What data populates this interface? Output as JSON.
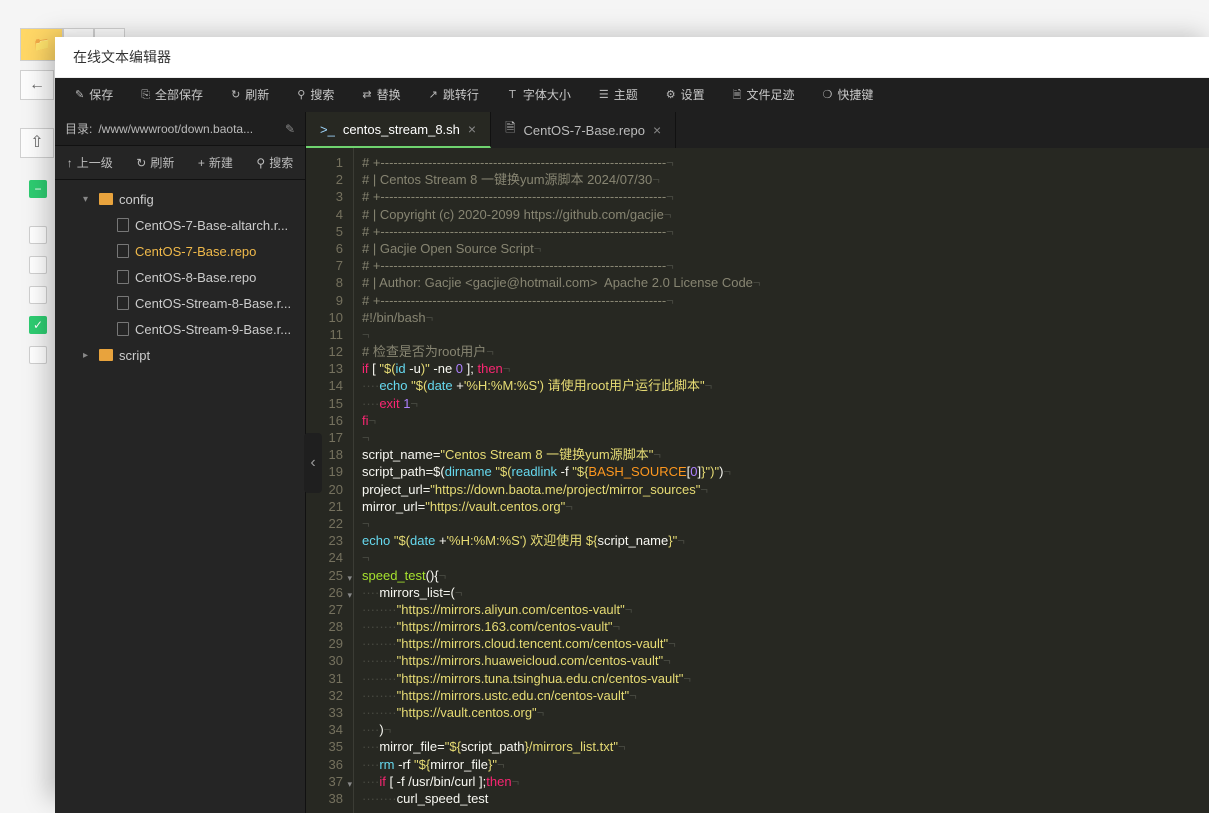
{
  "modal_title": "在线文本编辑器",
  "toolbar": [
    {
      "icon": "✎",
      "label": "保存"
    },
    {
      "icon": "⎘",
      "label": "全部保存"
    },
    {
      "icon": "↻",
      "label": "刷新"
    },
    {
      "icon": "⚲",
      "label": "搜索"
    },
    {
      "icon": "⇄",
      "label": "替换"
    },
    {
      "icon": "↗",
      "label": "跳转行"
    },
    {
      "icon": "Ｔ",
      "label": "字体大小"
    },
    {
      "icon": "☰",
      "label": "主题"
    },
    {
      "icon": "⚙",
      "label": "设置"
    },
    {
      "icon": "🗎",
      "label": "文件足迹"
    },
    {
      "icon": "❍",
      "label": "快捷键"
    }
  ],
  "path_label": "目录:",
  "path_value": "/www/wwwroot/down.baota...",
  "side_tools": [
    {
      "icon": "↑",
      "label": "上一级"
    },
    {
      "icon": "↻",
      "label": "刷新"
    },
    {
      "icon": "+",
      "label": "新建"
    },
    {
      "icon": "⚲",
      "label": "搜索"
    }
  ],
  "tree": [
    {
      "type": "folder",
      "name": "config",
      "expanded": true,
      "level": 1
    },
    {
      "type": "file",
      "name": "CentOS-7-Base-altarch.r...",
      "level": 2
    },
    {
      "type": "file",
      "name": "CentOS-7-Base.repo",
      "level": 2,
      "active": true
    },
    {
      "type": "file",
      "name": "CentOS-8-Base.repo",
      "level": 2
    },
    {
      "type": "file",
      "name": "CentOS-Stream-8-Base.r...",
      "level": 2
    },
    {
      "type": "file",
      "name": "CentOS-Stream-9-Base.r...",
      "level": 2
    },
    {
      "type": "folder",
      "name": "script",
      "expanded": false,
      "level": 1
    }
  ],
  "tabs": [
    {
      "icon": ">_",
      "label": "centos_stream_8.sh",
      "active": true,
      "icon_class": "script"
    },
    {
      "icon": "🗎",
      "label": "CentOS-7-Base.repo",
      "active": false
    }
  ],
  "code": [
    {
      "n": 1,
      "html": "<span class='c-comment'># +------------------------------------------------------------------</span><span class='nl'>¬</span>"
    },
    {
      "n": 2,
      "html": "<span class='c-comment'># | Centos Stream 8 一键换yum源脚本 2024/07/30</span><span class='nl'>¬</span>"
    },
    {
      "n": 3,
      "html": "<span class='c-comment'># +------------------------------------------------------------------</span><span class='nl'>¬</span>"
    },
    {
      "n": 4,
      "html": "<span class='c-comment'># | Copyright (c) 2020-2099 https://github.com/gacjie</span><span class='nl'>¬</span>"
    },
    {
      "n": 5,
      "html": "<span class='c-comment'># +------------------------------------------------------------------</span><span class='nl'>¬</span>"
    },
    {
      "n": 6,
      "html": "<span class='c-comment'># | Gacjie Open Source Script</span><span class='nl'>¬</span>"
    },
    {
      "n": 7,
      "html": "<span class='c-comment'># +------------------------------------------------------------------</span><span class='nl'>¬</span>"
    },
    {
      "n": 8,
      "html": "<span class='c-comment'># | Author: Gacjie &lt;gacjie@hotmail.com&gt;  Apache 2.0 License Code</span><span class='nl'>¬</span>"
    },
    {
      "n": 9,
      "html": "<span class='c-comment'># +------------------------------------------------------------------</span><span class='nl'>¬</span>"
    },
    {
      "n": 10,
      "html": "<span class='c-comment'>#!/bin/bash</span><span class='nl'>¬</span>"
    },
    {
      "n": 11,
      "html": "<span class='nl'>¬</span>"
    },
    {
      "n": 12,
      "html": "<span class='c-comment'># 检查是否为root用户</span><span class='nl'>¬</span>"
    },
    {
      "n": 13,
      "html": "<span class='c-kw'>if</span><span class='c-op'> [ </span><span class='c-str'>\"$(</span><span class='c-fn'>id</span><span class='c-op'> -u</span><span class='c-str'>)\"</span><span class='c-op'> -ne </span><span class='c-num'>0</span><span class='c-op'> ]; </span><span class='c-kw'>then</span><span class='nl'>¬</span>"
    },
    {
      "n": 14,
      "html": "<span class='ws'>····</span><span class='c-fn'>echo</span><span class='c-op'> </span><span class='c-str'>\"$(</span><span class='c-fn'>date</span><span class='c-op'> +</span><span class='c-str'>'%H:%M:%S') 请使用root用户运行此脚本\"</span><span class='nl'>¬</span>"
    },
    {
      "n": 15,
      "html": "<span class='ws'>····</span><span class='c-kw'>exit</span><span class='c-op'> </span><span class='c-num'>1</span><span class='nl'>¬</span>"
    },
    {
      "n": 16,
      "html": "<span class='c-kw'>fi</span><span class='nl'>¬</span>"
    },
    {
      "n": 17,
      "html": "<span class='nl'>¬</span>"
    },
    {
      "n": 18,
      "html": "<span class='c-var'>script_name</span><span class='c-op'>=</span><span class='c-str'>\"Centos Stream 8 一键换yum源脚本\"</span><span class='nl'>¬</span>"
    },
    {
      "n": 19,
      "html": "<span class='c-var'>script_path</span><span class='c-op'>=$(</span><span class='c-fn'>dirname</span><span class='c-op'> </span><span class='c-str'>\"$(</span><span class='c-fn'>readlink</span><span class='c-op'> -f </span><span class='c-str'>\"${</span><span class='c-param'>BASH_SOURCE</span><span class='c-op'>[</span><span class='c-num'>0</span><span class='c-op'>]</span><span class='c-str'>}\")\"</span><span class='c-op'>)</span><span class='nl'>¬</span>"
    },
    {
      "n": 20,
      "html": "<span class='c-var'>project_url</span><span class='c-op'>=</span><span class='c-str'>\"https://down.baota.me/project/mirror_sources\"</span><span class='nl'>¬</span>"
    },
    {
      "n": 21,
      "html": "<span class='c-var'>mirror_url</span><span class='c-op'>=</span><span class='c-str'>\"https://vault.centos.org\"</span><span class='nl'>¬</span>"
    },
    {
      "n": 22,
      "html": "<span class='nl'>¬</span>"
    },
    {
      "n": 23,
      "html": "<span class='c-fn'>echo</span><span class='c-op'> </span><span class='c-str'>\"$(</span><span class='c-fn'>date</span><span class='c-op'> +</span><span class='c-str'>'%H:%M:%S') 欢迎使用 ${</span><span class='c-var'>script_name</span><span class='c-str'>}\"</span><span class='nl'>¬</span>"
    },
    {
      "n": 24,
      "html": "<span class='nl'>¬</span>"
    },
    {
      "n": 25,
      "fold": true,
      "html": "<span class='c-name'>speed_test</span><span class='c-op'>(){</span><span class='nl'>¬</span>"
    },
    {
      "n": 26,
      "fold": true,
      "html": "<span class='ws'>····</span><span class='c-var'>mirrors_list</span><span class='c-op'>=(</span><span class='nl'>¬</span>"
    },
    {
      "n": 27,
      "html": "<span class='ws'>········</span><span class='c-str'>\"https://mirrors.aliyun.com/centos-vault\"</span><span class='nl'>¬</span>"
    },
    {
      "n": 28,
      "html": "<span class='ws'>········</span><span class='c-str'>\"https://mirrors.163.com/centos-vault\"</span><span class='nl'>¬</span>"
    },
    {
      "n": 29,
      "html": "<span class='ws'>········</span><span class='c-str'>\"https://mirrors.cloud.tencent.com/centos-vault\"</span><span class='nl'>¬</span>"
    },
    {
      "n": 30,
      "html": "<span class='ws'>········</span><span class='c-str'>\"https://mirrors.huaweicloud.com/centos-vault\"</span><span class='nl'>¬</span>"
    },
    {
      "n": 31,
      "html": "<span class='ws'>········</span><span class='c-str'>\"https://mirrors.tuna.tsinghua.edu.cn/centos-vault\"</span><span class='nl'>¬</span>"
    },
    {
      "n": 32,
      "html": "<span class='ws'>········</span><span class='c-str'>\"https://mirrors.ustc.edu.cn/centos-vault\"</span><span class='nl'>¬</span>"
    },
    {
      "n": 33,
      "html": "<span class='ws'>········</span><span class='c-str'>\"https://vault.centos.org\"</span><span class='nl'>¬</span>"
    },
    {
      "n": 34,
      "html": "<span class='ws'>····</span><span class='c-op'>)</span><span class='nl'>¬</span>"
    },
    {
      "n": 35,
      "html": "<span class='ws'>····</span><span class='c-var'>mirror_file</span><span class='c-op'>=</span><span class='c-str'>\"${</span><span class='c-var'>script_path</span><span class='c-str'>}/mirrors_list.txt\"</span><span class='nl'>¬</span>"
    },
    {
      "n": 36,
      "html": "<span class='ws'>····</span><span class='c-fn'>rm</span><span class='c-op'> -rf </span><span class='c-str'>\"${</span><span class='c-var'>mirror_file</span><span class='c-str'>}\"</span><span class='nl'>¬</span>"
    },
    {
      "n": 37,
      "fold": true,
      "html": "<span class='ws'>····</span><span class='c-kw'>if</span><span class='c-op'> [ -f /usr/bin/curl ];</span><span class='c-kw'>then</span><span class='nl'>¬</span>"
    },
    {
      "n": 38,
      "html": "<span class='ws'>········</span><span class='c-var'>curl_speed_test</span>"
    }
  ]
}
